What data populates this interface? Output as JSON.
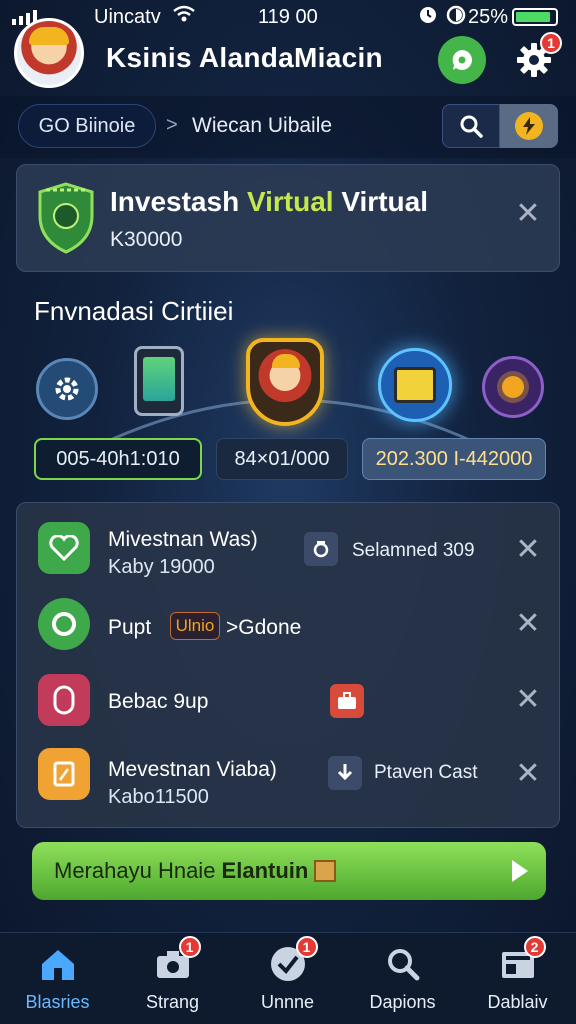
{
  "status_bar": {
    "carrier": "Uincatv",
    "time": "119 00",
    "battery": "25%"
  },
  "header": {
    "title": "Ksinis  AlandaMiacin",
    "settings_badge": "1"
  },
  "breadcrumb": {
    "root": "GO Biinoie",
    "separator": ">",
    "current": "Wiecan Uibaile"
  },
  "invest_card": {
    "title_a": "Investash ",
    "title_highlight": "Virtual",
    "title_b": " Virtual",
    "amount": "K30000"
  },
  "section": {
    "title": "Fnvnadasi Cirtiiei"
  },
  "value_pills": [
    "005-40h1:010",
    "84×01/000",
    "202.300 I-442000"
  ],
  "list": [
    {
      "title": "Mivestnan Was)",
      "sub": "Kaby 19000",
      "side_label": "Selamned 309"
    },
    {
      "title": "Pupt",
      "tag": "Ulnio",
      "suffix": ">Gdone"
    },
    {
      "title": "Bebac 9up"
    },
    {
      "title": "Mevestnan Viaba)",
      "sub": "Kabo11500",
      "side_label": "Ptaven Cast"
    }
  ],
  "cta": {
    "label_a": "Merahayu Hnaie ",
    "label_b": "Elantuin"
  },
  "bottom_nav": [
    {
      "label": "Blasries",
      "badge": ""
    },
    {
      "label": "Strang",
      "badge": "1"
    },
    {
      "label": "Unnne",
      "badge": "1"
    },
    {
      "label": "Dapions",
      "badge": ""
    },
    {
      "label": "Dablaiv",
      "badge": "2"
    }
  ],
  "colors": {
    "accent_green": "#7cd74a",
    "primary_blue": "#6cb8ff",
    "badge_red": "#e53935",
    "gold": "#f2b51f"
  },
  "icons": [
    "signal-icon",
    "wifi-icon",
    "alarm-icon",
    "dnd-icon",
    "battery-icon",
    "chat-icon",
    "gear-icon",
    "search-icon",
    "bolt-icon",
    "shield-icon",
    "close-icon",
    "home-icon",
    "camera-icon",
    "check-icon",
    "search-icon",
    "dashboard-icon",
    "play-icon"
  ]
}
